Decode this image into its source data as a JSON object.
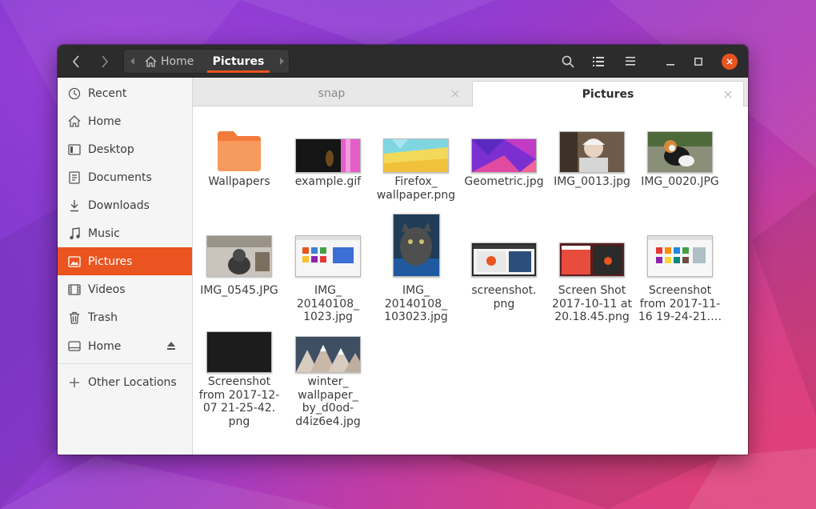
{
  "window": {
    "nav": {
      "back_icon": "chevron-left-icon",
      "forward_icon": "chevron-right-icon"
    },
    "path": {
      "home_label": "Home",
      "current_label": "Pictures"
    },
    "toolbar": {
      "search_icon": "search-icon",
      "view_icon": "list-view-icon",
      "menu_icon": "hamburger-menu-icon"
    },
    "controls": {
      "minimize_icon": "minimize-icon",
      "maximize_icon": "maximize-icon",
      "close_icon": "close-icon",
      "close_color": "#e95420"
    }
  },
  "sidebar": {
    "items": [
      {
        "label": "Recent",
        "icon": "clock-icon"
      },
      {
        "label": "Home",
        "icon": "home-icon"
      },
      {
        "label": "Desktop",
        "icon": "desktop-icon"
      },
      {
        "label": "Documents",
        "icon": "document-icon"
      },
      {
        "label": "Downloads",
        "icon": "download-icon"
      },
      {
        "label": "Music",
        "icon": "music-note-icon"
      },
      {
        "label": "Pictures",
        "icon": "picture-icon",
        "active": true
      },
      {
        "label": "Videos",
        "icon": "film-icon"
      },
      {
        "label": "Trash",
        "icon": "trash-icon"
      },
      {
        "label": "Home",
        "icon": "drive-icon",
        "eject_icon": "eject-icon"
      }
    ],
    "other": {
      "label": "Other Locations",
      "icon": "plus-icon"
    },
    "accent_color": "#e95420"
  },
  "tabs": [
    {
      "label": "snap",
      "active": false
    },
    {
      "label": "Pictures",
      "active": true
    }
  ],
  "files": [
    {
      "name": "Wallpapers",
      "kind": "folder-icon"
    },
    {
      "name": "example.gif"
    },
    {
      "name": "Firefox_\nwallpaper.png"
    },
    {
      "name": "Geometric.jpg"
    },
    {
      "name": "IMG_0013.jpg"
    },
    {
      "name": "IMG_0020.JPG"
    },
    {
      "name": "IMG_0545.JPG"
    },
    {
      "name": "IMG_\n20140108_\n1023.jpg"
    },
    {
      "name": "IMG_\n20140108_\n103023.jpg"
    },
    {
      "name": "screenshot.\npng"
    },
    {
      "name": "Screen Shot\n2017-10-11 at\n20.18.45.png"
    },
    {
      "name": "Screenshot\nfrom 2017-11-\n16 19-24-21.…"
    },
    {
      "name": "Screenshot\nfrom 2017-12-\n07 21-25-42.\npng"
    },
    {
      "name": "winter_\nwallpaper_\nby_d0od-\nd4iz6e4.jpg"
    }
  ]
}
